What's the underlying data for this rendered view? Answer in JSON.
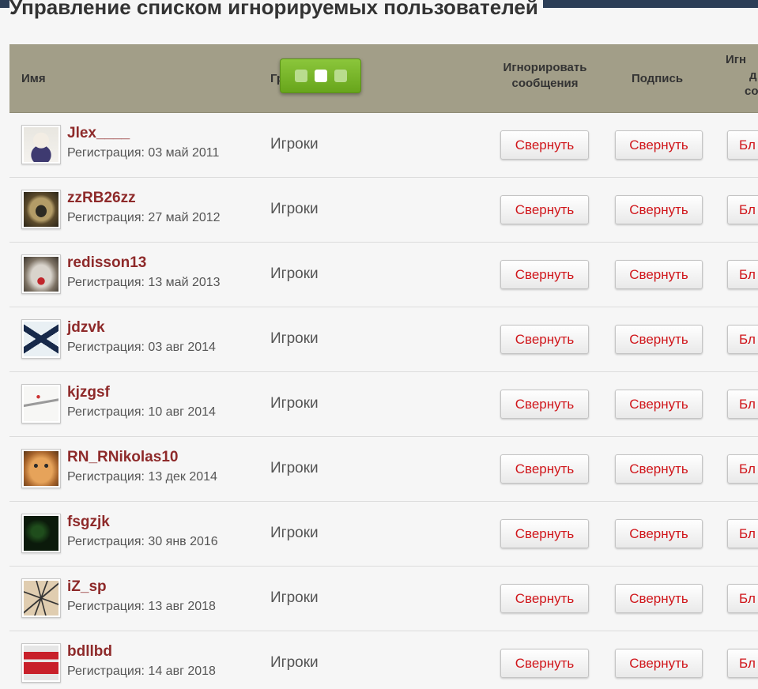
{
  "page": {
    "title": "Управление списком игнорируемых пользователей"
  },
  "table": {
    "columns": {
      "name": "Имя",
      "group": "Гр",
      "ignore_line1": "Игнорировать",
      "ignore_line2": "сообщения",
      "signature": "Подпись",
      "more_line1": "Игн",
      "more_line2": "д",
      "more_line3": "со"
    },
    "rows": [
      {
        "username": "Jlex____",
        "registered": "Регистрация: 03 май 2011",
        "group": "Игроки",
        "btn_messages": "Свернуть",
        "btn_signature": "Свернуть",
        "btn_more": "Бл",
        "avatar": "avatar-anime-icon"
      },
      {
        "username": "zzRB26zz",
        "registered": "Регистрация: 27 май 2012",
        "group": "Игроки",
        "btn_messages": "Свернуть",
        "btn_signature": "Свернуть",
        "btn_more": "Бл",
        "avatar": "avatar-dog-icon"
      },
      {
        "username": "redisson13",
        "registered": "Регистрация: 13 май 2013",
        "group": "Игроки",
        "btn_messages": "Свернуть",
        "btn_signature": "Свернуть",
        "btn_more": "Бл",
        "avatar": "avatar-lynx-icon"
      },
      {
        "username": "jdzvk",
        "registered": "Регистрация: 03 авг 2014",
        "group": "Игроки",
        "btn_messages": "Свернуть",
        "btn_signature": "Свернуть",
        "btn_more": "Бл",
        "avatar": "avatar-flag-icon"
      },
      {
        "username": "kjzgsf",
        "registered": "Регистрация: 10 авг 2014",
        "group": "Игроки",
        "btn_messages": "Свернуть",
        "btn_signature": "Свернуть",
        "btn_more": "Бл",
        "avatar": "avatar-sketch-icon"
      },
      {
        "username": "RN_RNikolas10",
        "registered": "Регистрация: 13 дек 2014",
        "group": "Игроки",
        "btn_messages": "Свернуть",
        "btn_signature": "Свернуть",
        "btn_more": "Бл",
        "avatar": "avatar-kitten-icon"
      },
      {
        "username": "fsgzjk",
        "registered": "Регистрация: 30 янв 2016",
        "group": "Игроки",
        "btn_messages": "Свернуть",
        "btn_signature": "Свернуть",
        "btn_more": "Бл",
        "avatar": "avatar-dark-green-icon"
      },
      {
        "username": "iZ_sp",
        "registered": "Регистрация: 13 авг 2018",
        "group": "Игроки",
        "btn_messages": "Свернуть",
        "btn_signature": "Свернуть",
        "btn_more": "Бл",
        "avatar": "avatar-lines-icon"
      },
      {
        "username": "bdllbd",
        "registered": "Регистрация: 14 авг 2018",
        "group": "Игроки",
        "btn_messages": "Свернуть",
        "btn_signature": "Свернуть",
        "btn_more": "Бл",
        "avatar": "avatar-red-sign-icon"
      }
    ]
  },
  "loader": {
    "dots": 3,
    "active_dot": 2
  },
  "colors": {
    "header_bg": "#a29e88",
    "username": "#8e2a2a",
    "button_text": "#d0161b",
    "loader_green": "#7ab52c"
  }
}
